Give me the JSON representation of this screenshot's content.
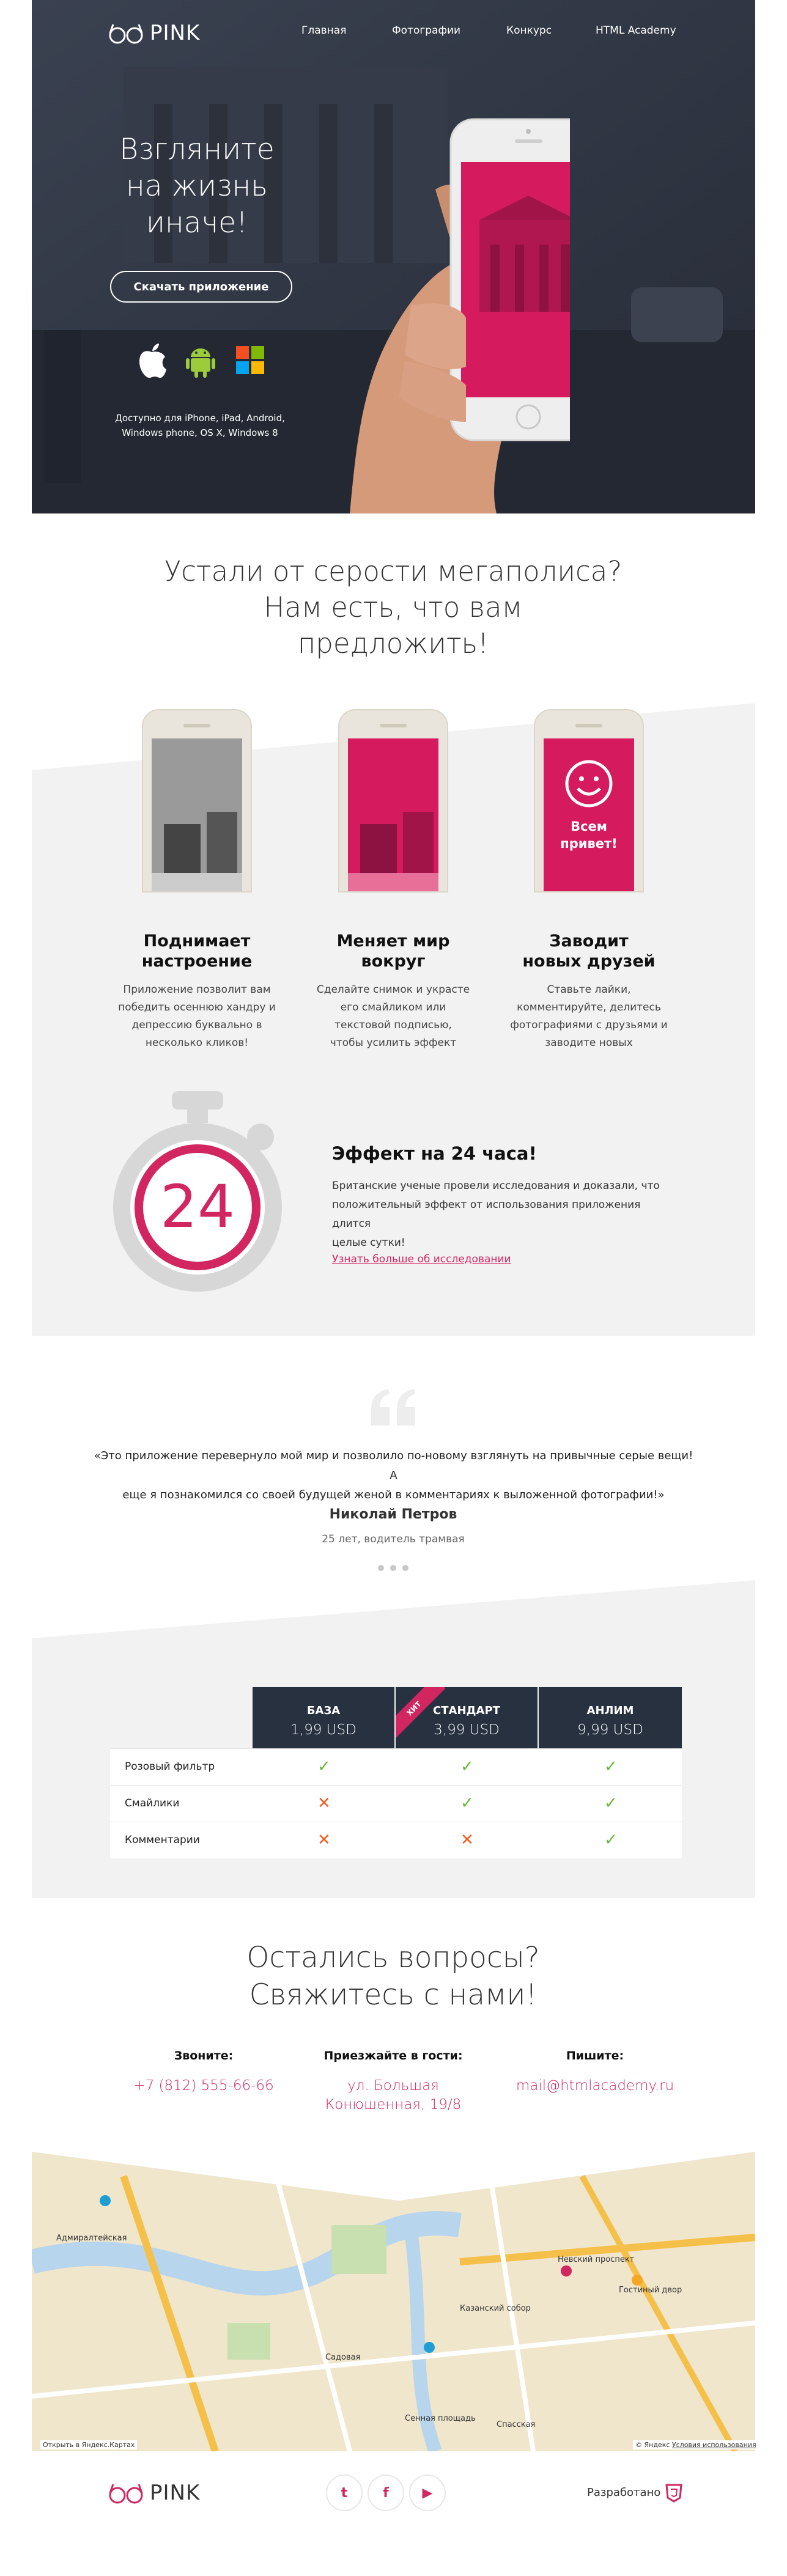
{
  "header": {
    "logo_text": "PINK",
    "nav": [
      "Главная",
      "Фотографии",
      "Конкурс",
      "HTML Academy"
    ]
  },
  "hero": {
    "title_lines": [
      "Взгляните",
      "на жизнь",
      "иначе!"
    ],
    "download_label": "Скачать приложение",
    "platform_icons": [
      "apple-icon",
      "android-icon",
      "windows-icon"
    ],
    "availability": [
      "Доступно для iPhone, iPad, Android,",
      "Windows phone, OS X, Windows 8"
    ]
  },
  "intro": {
    "title_lines": [
      "Устали от серости мегаполиса?",
      "Нам есть, что вам",
      "предложить!"
    ]
  },
  "features": [
    {
      "title_lines": [
        "Поднимает",
        "настроение"
      ],
      "text_lines": [
        "Приложение позволит вам",
        "победить осеннюю хандру и",
        "депрессию буквально в",
        "несколько кликов!"
      ]
    },
    {
      "title_lines": [
        "Меняет мир",
        "вокруг"
      ],
      "text_lines": [
        "Сделайте снимок и украсте",
        "его смайликом или",
        "текстовой подписью,",
        "чтобы усилить эффект"
      ]
    },
    {
      "title_lines": [
        "Заводит",
        "новых друзей"
      ],
      "text_lines": [
        "Ставьте лайки,",
        "комментируйте, делитесь",
        "фотографиями с друзьями и",
        "заводите новых"
      ]
    }
  ],
  "phone3_caption": [
    "Всем",
    "привет!"
  ],
  "effect": {
    "number": "24",
    "title": "Эффект на 24 часа!",
    "text_lines": [
      "Британские ученые провели исследования и доказали, что",
      "положительный эффект от использования приложения длится",
      "целые сутки!"
    ],
    "link": "Узнать больше об исследовании"
  },
  "review": {
    "text_lines": [
      "«Это приложение перевернуло мой мир и позволило по-новому взглянуть на привычные серые вещи! А",
      "еще я познакомился со своей будущей женой в комментариях к выложенной фотографии!»"
    ],
    "name": "Николай Петров",
    "role": "25 лет, водитель трамвая"
  },
  "pricing": {
    "plans": [
      {
        "name": "БАЗА",
        "price": "1,99 USD"
      },
      {
        "name": "СТАНДАРТ",
        "price": "3,99 USD"
      },
      {
        "name": "АНЛИМ",
        "price": "9,99 USD"
      }
    ],
    "hit_label": "ХИТ",
    "rows": [
      {
        "label": "Розовый фильтр",
        "marks": [
          true,
          true,
          true
        ]
      },
      {
        "label": "Смайлики",
        "marks": [
          false,
          true,
          true
        ]
      },
      {
        "label": "Комментарии",
        "marks": [
          false,
          false,
          true
        ]
      }
    ],
    "colors": {
      "yes": "#68b738",
      "no": "#f05d22"
    }
  },
  "contacts": {
    "title_lines": [
      "Остались вопросы?",
      "Свяжитесь с нами!"
    ],
    "items": [
      {
        "title": "Звоните:",
        "value_lines": [
          "+7 (812) 555-66-66"
        ]
      },
      {
        "title": "Приезжайте в гости:",
        "value_lines": [
          "ул. Большая",
          "Конюшенная, 19/8"
        ]
      },
      {
        "title": "Пишите:",
        "value_lines": [
          "mail@htmlacademy.ru"
        ]
      }
    ]
  },
  "map": {
    "open_link": "Открыть в Яндекс.Картах",
    "copyright": "© Яндекс",
    "terms": "Условия использования",
    "labels": [
      "Адмиралтейская",
      "Невский проспект",
      "Сенная площадь",
      "Гостиный двор",
      "Садовая",
      "Спасская",
      "Казанский собор"
    ]
  },
  "footer": {
    "logo_text": "PINK",
    "social": [
      "t",
      "f",
      "▶"
    ],
    "made_by": "Разработано"
  },
  "colors": {
    "accent": "#d22660",
    "dark": "#283140"
  }
}
